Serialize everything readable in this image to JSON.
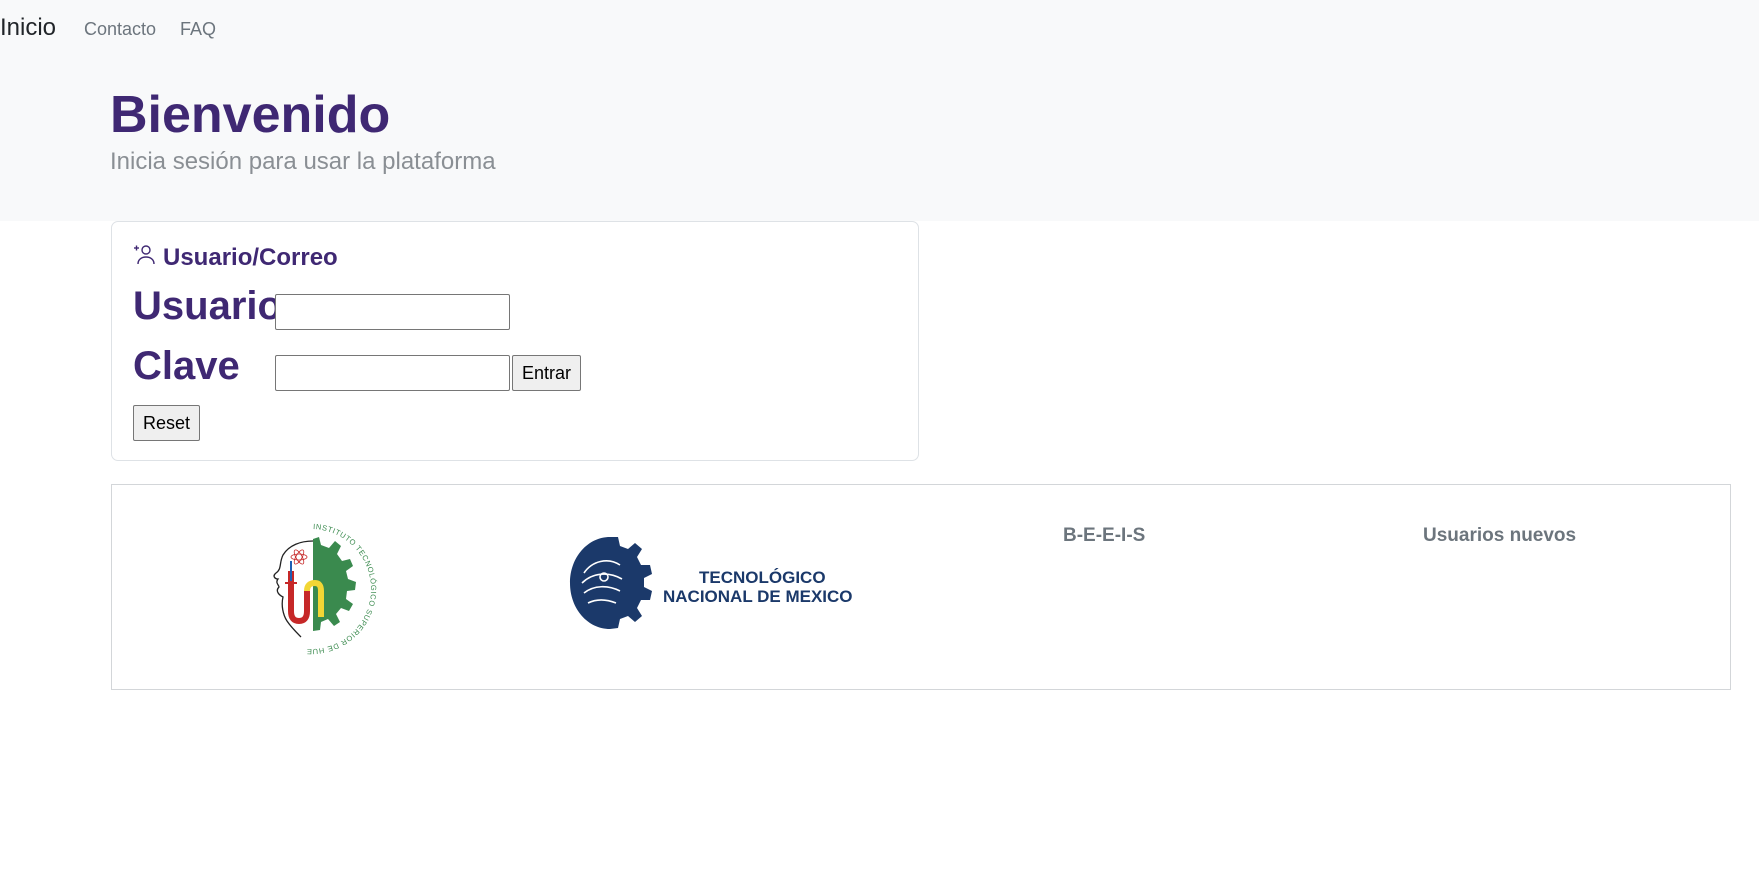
{
  "nav": {
    "brand": "Inicio",
    "links": [
      "Contacto",
      "FAQ"
    ]
  },
  "hero": {
    "title": "Bienvenido",
    "subtitle": "Inicia sesión para usar la plataforma"
  },
  "login": {
    "header_icon": "add-user-icon",
    "header_title": "Usuario/Correo",
    "user_label": "Usuario",
    "user_value": "",
    "password_label": "Clave",
    "password_value": "",
    "submit_label": "Entrar",
    "reset_label": "Reset"
  },
  "footer": {
    "institute_logo_text": "INSTITUTO TECNOLÓGICO SUPERIOR DE HUETAMO",
    "tecnm_logo_line1": "TECNOLÓGICO",
    "tecnm_logo_line2": "NACIONAL DE MEXICO",
    "col3_title": "B-E-E-I-S",
    "col4_title": "Usuarios nuevos"
  },
  "colors": {
    "accent": "#3f2873",
    "topbar_bg": "#f8f9fa",
    "muted": "#6c757d",
    "tecnm_blue": "#1b396a",
    "institute_green": "#3a8a4e"
  }
}
